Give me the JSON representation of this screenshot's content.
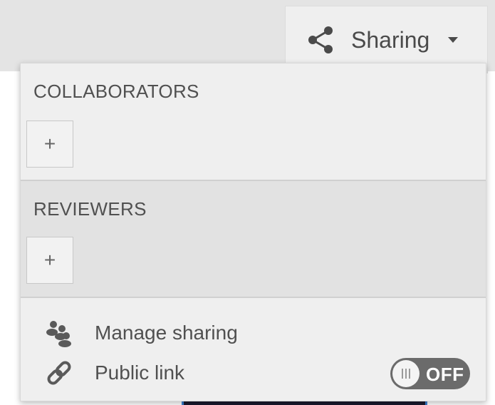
{
  "header": {
    "sharing_label": "Sharing",
    "share_icon": "share-icon",
    "caret_icon": "caret-down-icon"
  },
  "panel": {
    "collaborators": {
      "title": "COLLABORATORS",
      "add_label": "+"
    },
    "reviewers": {
      "title": "REVIEWERS",
      "add_label": "+"
    },
    "manage_sharing": {
      "label": "Manage sharing",
      "icon": "people-icon"
    },
    "public_link": {
      "label": "Public link",
      "icon": "link-icon",
      "toggle_label": "OFF",
      "toggle_on": false
    }
  },
  "colors": {
    "panel_bg": "#efefef",
    "reviewers_bg": "#e2e2e2",
    "toggle_bg": "#6b6b6b",
    "text": "#4a4a4a"
  }
}
